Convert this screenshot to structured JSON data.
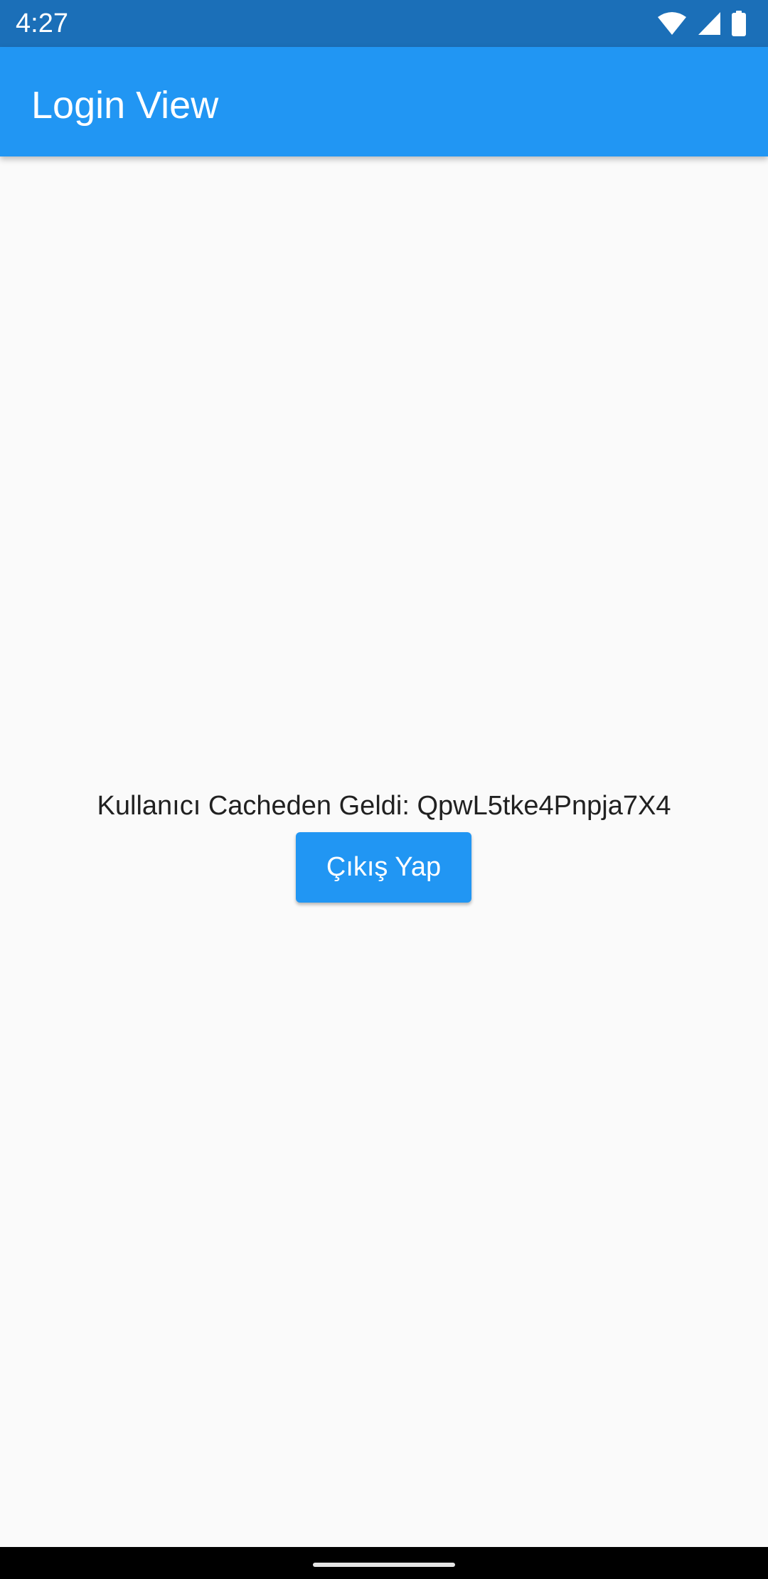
{
  "status_bar": {
    "time": "4:27",
    "icons": [
      "wifi-icon",
      "cellular-signal-icon",
      "battery-icon"
    ],
    "background_color": "#1B6FB8"
  },
  "app_bar": {
    "title": "Login View",
    "color": "#2196F3"
  },
  "content": {
    "message": "Kullanıcı Cacheden Geldi: QpwL5tke4Pnpja7X4",
    "logout_button_label": "Çıkış Yap"
  },
  "nav_bar": {
    "background_color": "#000000"
  }
}
